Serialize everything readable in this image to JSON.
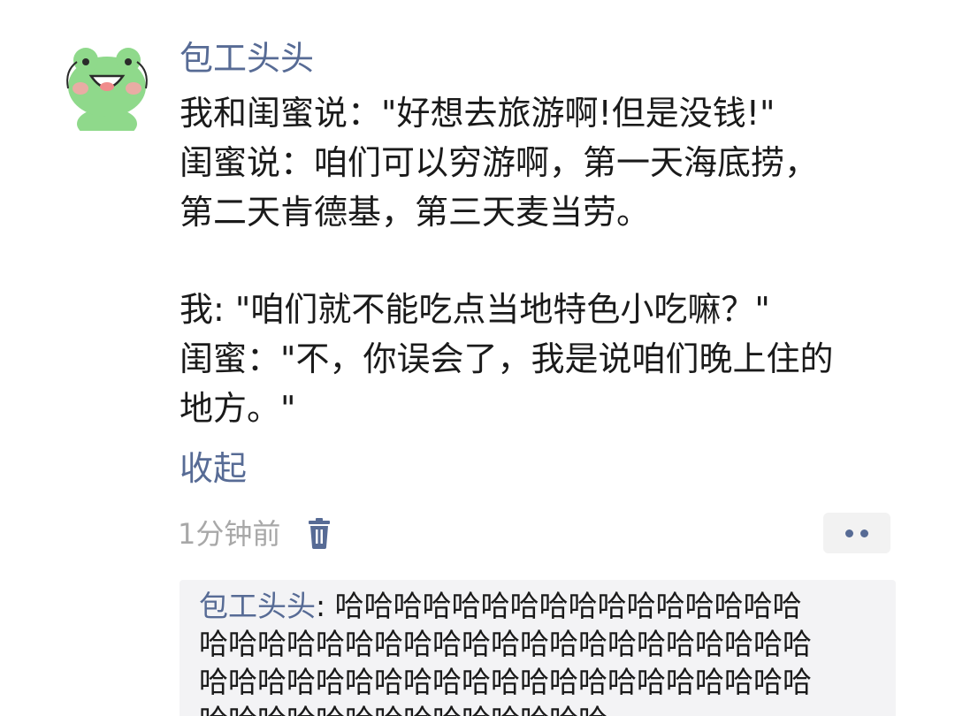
{
  "post": {
    "author": "包工头头",
    "lines": [
      "我和闺蜜说：\"好想去旅游啊!但是没钱!\"",
      "闺蜜说：咱们可以穷游啊，第一天海底捞，",
      "第二天肯德基，第三天麦当劳。",
      "我: \"咱们就不能吃点当地特色小吃嘛？\"",
      "闺蜜：\"不，你误会了，我是说咱们晚上住的",
      "地方。\""
    ],
    "collapse_label": "收起",
    "timestamp": "1分钟前"
  },
  "comment": {
    "author": "包工头头",
    "separator": ": ",
    "lines": [
      "哈哈哈哈哈哈哈哈哈哈哈哈哈哈哈哈",
      "哈哈哈哈哈哈哈哈哈哈哈哈哈哈哈哈哈哈哈哈哈",
      "哈哈哈哈哈哈哈哈哈哈哈哈哈哈哈哈哈哈哈哈哈",
      "哈哈哈哈哈哈哈哈哈哈哈哈哈哈"
    ]
  },
  "icons": {
    "avatar": "frog-avatar",
    "delete": "trash-icon",
    "more": "more-dots-icon"
  },
  "colors": {
    "link": "#576b95",
    "text": "#1a1a1a",
    "muted": "#a8a8a8",
    "comment_bg": "#f3f3f5",
    "frog_green": "#8fd98b"
  }
}
